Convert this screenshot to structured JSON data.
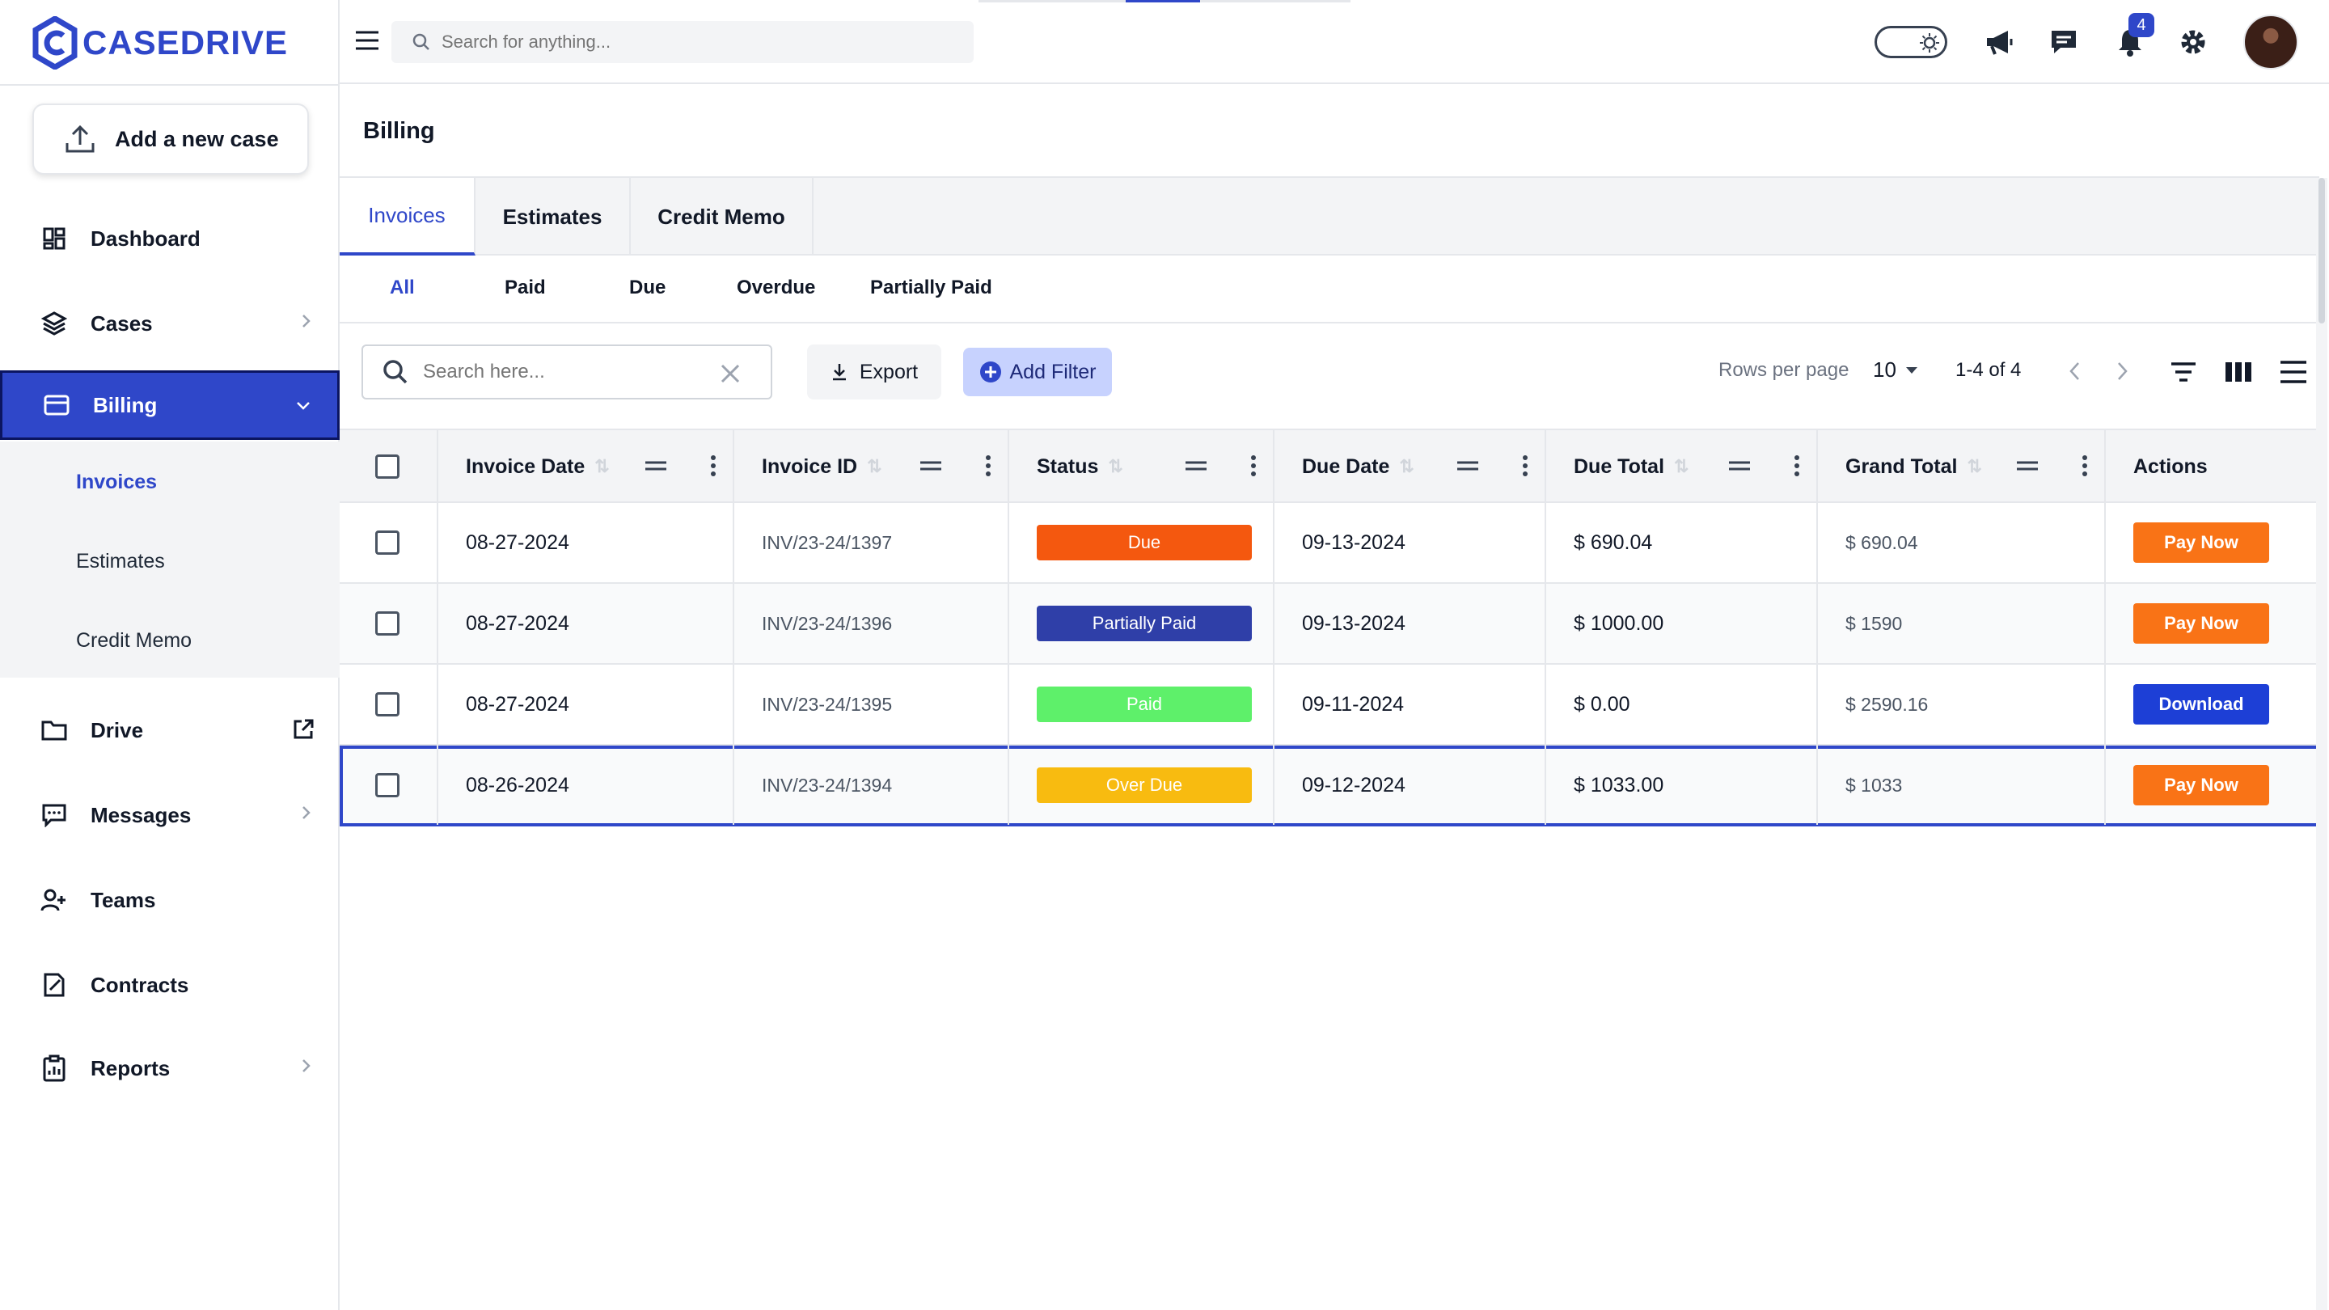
{
  "brand": {
    "name": "CASEDRIVE",
    "color": "#2f47c9"
  },
  "sidebar": {
    "add_case_label": "Add a new case",
    "items": [
      {
        "label": "Dashboard",
        "icon": "dashboard-icon"
      },
      {
        "label": "Cases",
        "icon": "layers-icon"
      },
      {
        "label": "Billing",
        "icon": "card-icon"
      },
      {
        "label": "Drive",
        "icon": "folder-icon"
      },
      {
        "label": "Messages",
        "icon": "message-icon"
      },
      {
        "label": "Teams",
        "icon": "users-icon"
      },
      {
        "label": "Contracts",
        "icon": "contract-icon"
      },
      {
        "label": "Reports",
        "icon": "clipboard-icon"
      }
    ],
    "billing_submenu": [
      "Invoices",
      "Estimates",
      "Credit Memo"
    ]
  },
  "topbar": {
    "search_placeholder": "Search for anything...",
    "notification_count": "4"
  },
  "page": {
    "title": "Billing",
    "tabs": [
      "Invoices",
      "Estimates",
      "Credit Memo"
    ],
    "filter_tabs": [
      "All",
      "Paid",
      "Due",
      "Overdue",
      "Partially Paid"
    ]
  },
  "toolbar": {
    "search_placeholder": "Search here...",
    "export_label": "Export",
    "add_filter_label": "Add Filter",
    "rows_per_page_label": "Rows per page",
    "rows_per_page_value": "10",
    "range": "1-4 of 4"
  },
  "table": {
    "columns": [
      "Invoice Date",
      "Invoice ID",
      "Status",
      "Due Date",
      "Due Total",
      "Grand Total",
      "Actions"
    ],
    "rows": [
      {
        "invoice_date": "08-27-2024",
        "invoice_id": "INV/23-24/1397",
        "status": "Due",
        "due_date": "09-13-2024",
        "due_total": "$ 690.04",
        "grand_total": "$ 690.04",
        "action": "Pay Now"
      },
      {
        "invoice_date": "08-27-2024",
        "invoice_id": "INV/23-24/1396",
        "status": "Partially Paid",
        "due_date": "09-13-2024",
        "due_total": "$ 1000.00",
        "grand_total": "$ 1590",
        "action": "Pay Now"
      },
      {
        "invoice_date": "08-27-2024",
        "invoice_id": "INV/23-24/1395",
        "status": "Paid",
        "due_date": "09-11-2024",
        "due_total": "$ 0.00",
        "grand_total": "$ 2590.16",
        "action": "Download"
      },
      {
        "invoice_date": "08-26-2024",
        "invoice_id": "INV/23-24/1394",
        "status": "Over Due",
        "due_date": "09-12-2024",
        "due_total": "$ 1033.00",
        "grand_total": "$ 1033",
        "action": "Pay Now"
      }
    ]
  },
  "colors": {
    "due": "#f4580f",
    "partially_paid": "#2f3fa8",
    "paid": "#5ef06a",
    "over_due": "#f8bb10",
    "pay_now": "#f97316",
    "download": "#1d3fd6"
  }
}
